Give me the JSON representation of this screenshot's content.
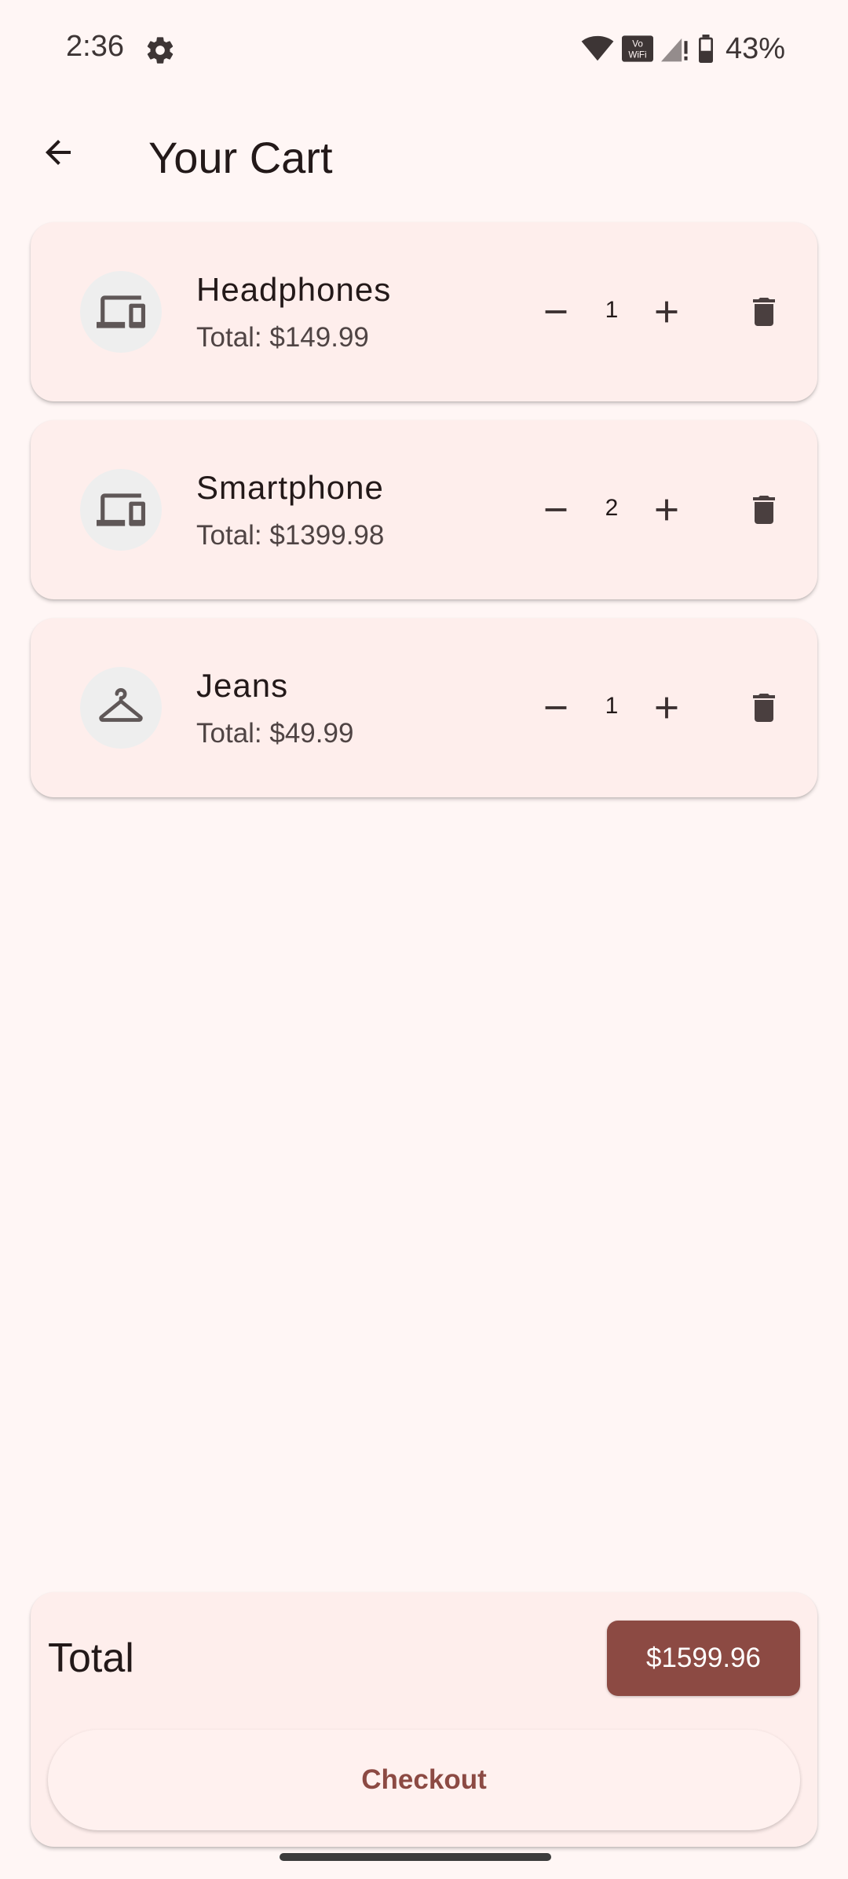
{
  "status_bar": {
    "time": "2:36",
    "battery": "43%",
    "icons": [
      "gear-icon",
      "wifi-icon",
      "vowifi-icon",
      "signal-icon",
      "battery-icon"
    ]
  },
  "app_bar": {
    "title": "Your Cart",
    "back_icon": "arrow-left-icon"
  },
  "cart": {
    "items": [
      {
        "name": "Headphones",
        "total": "Total: $149.99",
        "quantity": "1",
        "icon": "devices-icon"
      },
      {
        "name": "Smartphone",
        "total": "Total: $1399.98",
        "quantity": "2",
        "icon": "devices-icon"
      },
      {
        "name": "Jeans",
        "total": "Total: $49.99",
        "quantity": "1",
        "icon": "hanger-icon"
      }
    ]
  },
  "summary": {
    "total_label": "Total",
    "total_value": "$1599.96",
    "checkout_label": "Checkout"
  },
  "colors": {
    "background": "#fff6f5",
    "card": "#feeeec",
    "accent": "#8c4a43",
    "text": "#231919"
  }
}
